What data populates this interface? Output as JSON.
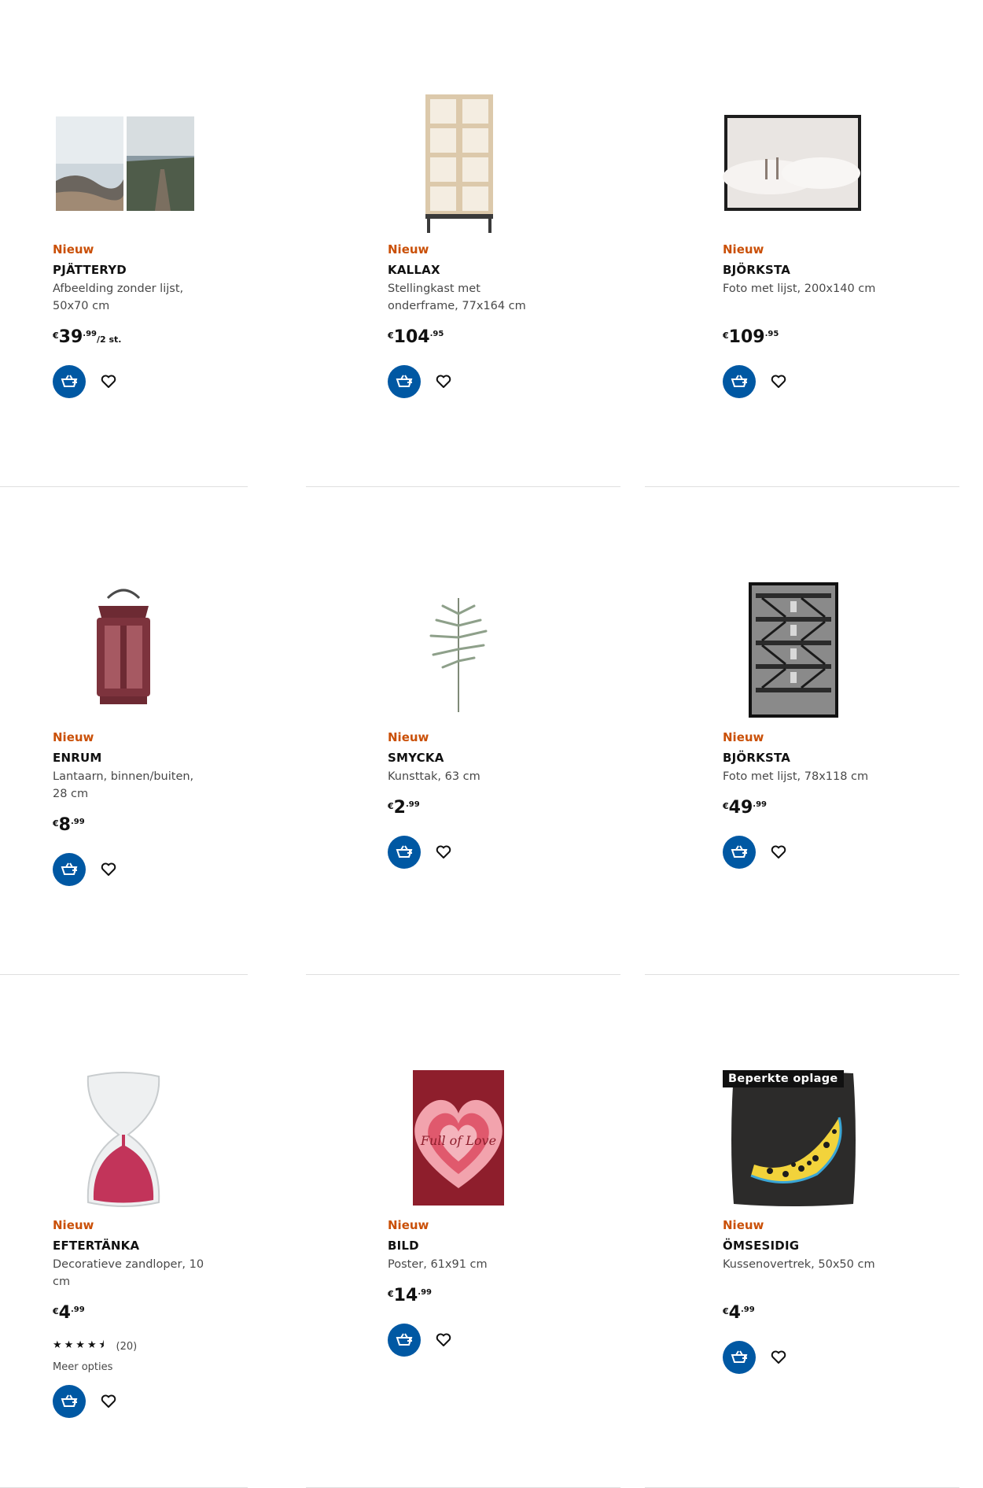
{
  "products": [
    {
      "badge": "Nieuw",
      "name": "PJÄTTERYD",
      "desc": "Afbeelding zonder lijst, 50x70 cm",
      "currency": "€",
      "price_int": "39",
      "price_dec": ".99",
      "price_unit": "/2 st."
    },
    {
      "badge": "Nieuw",
      "name": "KALLAX",
      "desc": "Stellingkast met onderframe, 77x164 cm",
      "currency": "€",
      "price_int": "104",
      "price_dec": ".95"
    },
    {
      "badge": "Nieuw",
      "name": "BJÖRKSTA",
      "desc": "Foto met lijst, 200x140 cm",
      "currency": "€",
      "price_int": "109",
      "price_dec": ".95"
    },
    {
      "badge": "Nieuw",
      "name": "ENRUM",
      "desc": "Lantaarn, binnen/buiten, 28 cm",
      "currency": "€",
      "price_int": "8",
      "price_dec": ".99"
    },
    {
      "badge": "Nieuw",
      "name": "SMYCKA",
      "desc": "Kunsttak, 63 cm",
      "currency": "€",
      "price_int": "2",
      "price_dec": ".99"
    },
    {
      "badge": "Nieuw",
      "name": "BJÖRKSTA",
      "desc": "Foto met lijst, 78x118 cm",
      "currency": "€",
      "price_int": "49",
      "price_dec": ".99"
    },
    {
      "badge": "Nieuw",
      "name": "EFTERTÄNKA",
      "desc": "Decoratieve zandloper, 10 cm",
      "currency": "€",
      "price_int": "4",
      "price_dec": ".99",
      "rating": 4.5,
      "rating_count": "(20)",
      "more_options": "Meer opties"
    },
    {
      "badge": "Nieuw",
      "name": "BILD",
      "desc": "Poster, 61x91 cm",
      "currency": "€",
      "price_int": "14",
      "price_dec": ".99",
      "poster_text": "Full of Love"
    },
    {
      "badge": "Nieuw",
      "name": "ÖMSESIDIG",
      "desc": "Kussenovertrek, 50x50 cm",
      "currency": "€",
      "price_int": "4",
      "price_dec": ".99",
      "label": "Beperkte oplage"
    }
  ],
  "icons": {
    "cart": "add-to-cart-icon",
    "favourite": "heart-icon",
    "star": "star-icon"
  },
  "colors": {
    "accent": "#0058a3",
    "new_badge": "#ca5008",
    "text": "#111111",
    "muted": "#484848",
    "divider": "#dfdfdf"
  }
}
